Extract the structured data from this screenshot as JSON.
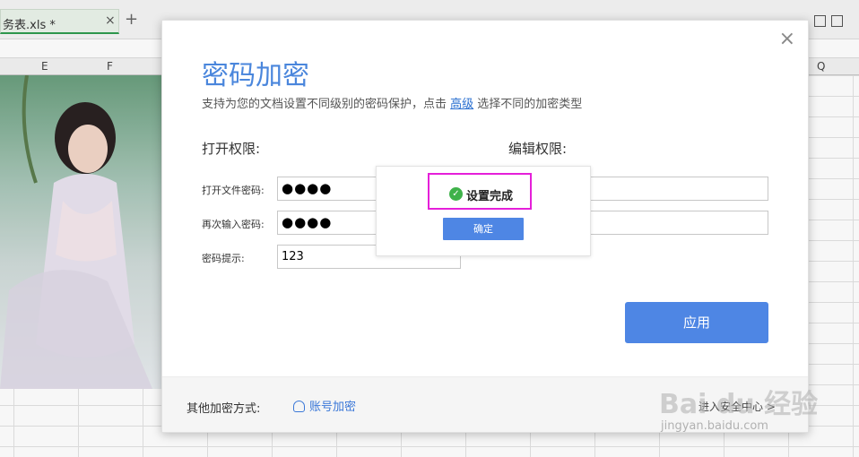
{
  "sheet": {
    "tab_label": "务表.xls *",
    "tab_close": "×",
    "tab_add": "+",
    "columns": [
      {
        "label": "E"
      },
      {
        "label": "F"
      },
      {
        "label": "Q"
      }
    ]
  },
  "dialog": {
    "close": "×",
    "title": "密码加密",
    "subtitle_before": "支持为您的文档设置不同级别的密码保护，点击 ",
    "subtitle_link": "高级",
    "subtitle_after": " 选择不同的加密类型",
    "open_section": "打开权限:",
    "edit_section": "编辑权限:",
    "fields": {
      "open_password_label": "打开文件密码:",
      "open_password_value": "●●●●",
      "reenter_label": "再次输入密码:",
      "reenter_value": "●●●●",
      "hint_label": "密码提示:",
      "hint_value": "123"
    },
    "apply_label": "应用",
    "footer": {
      "other_label": "其他加密方式:",
      "account_label": "账号加密",
      "security_label": "进入安全中心 >"
    }
  },
  "popup": {
    "check": "✓",
    "message": "设置完成",
    "ok_label": "确定"
  },
  "watermark": {
    "text": "Bai du 经验",
    "url": "jingyan.baidu.com"
  },
  "colors": {
    "accent": "#4e86e4",
    "title": "#4a86dc",
    "success": "#3fb24a",
    "highlight": "#e51fd9"
  }
}
